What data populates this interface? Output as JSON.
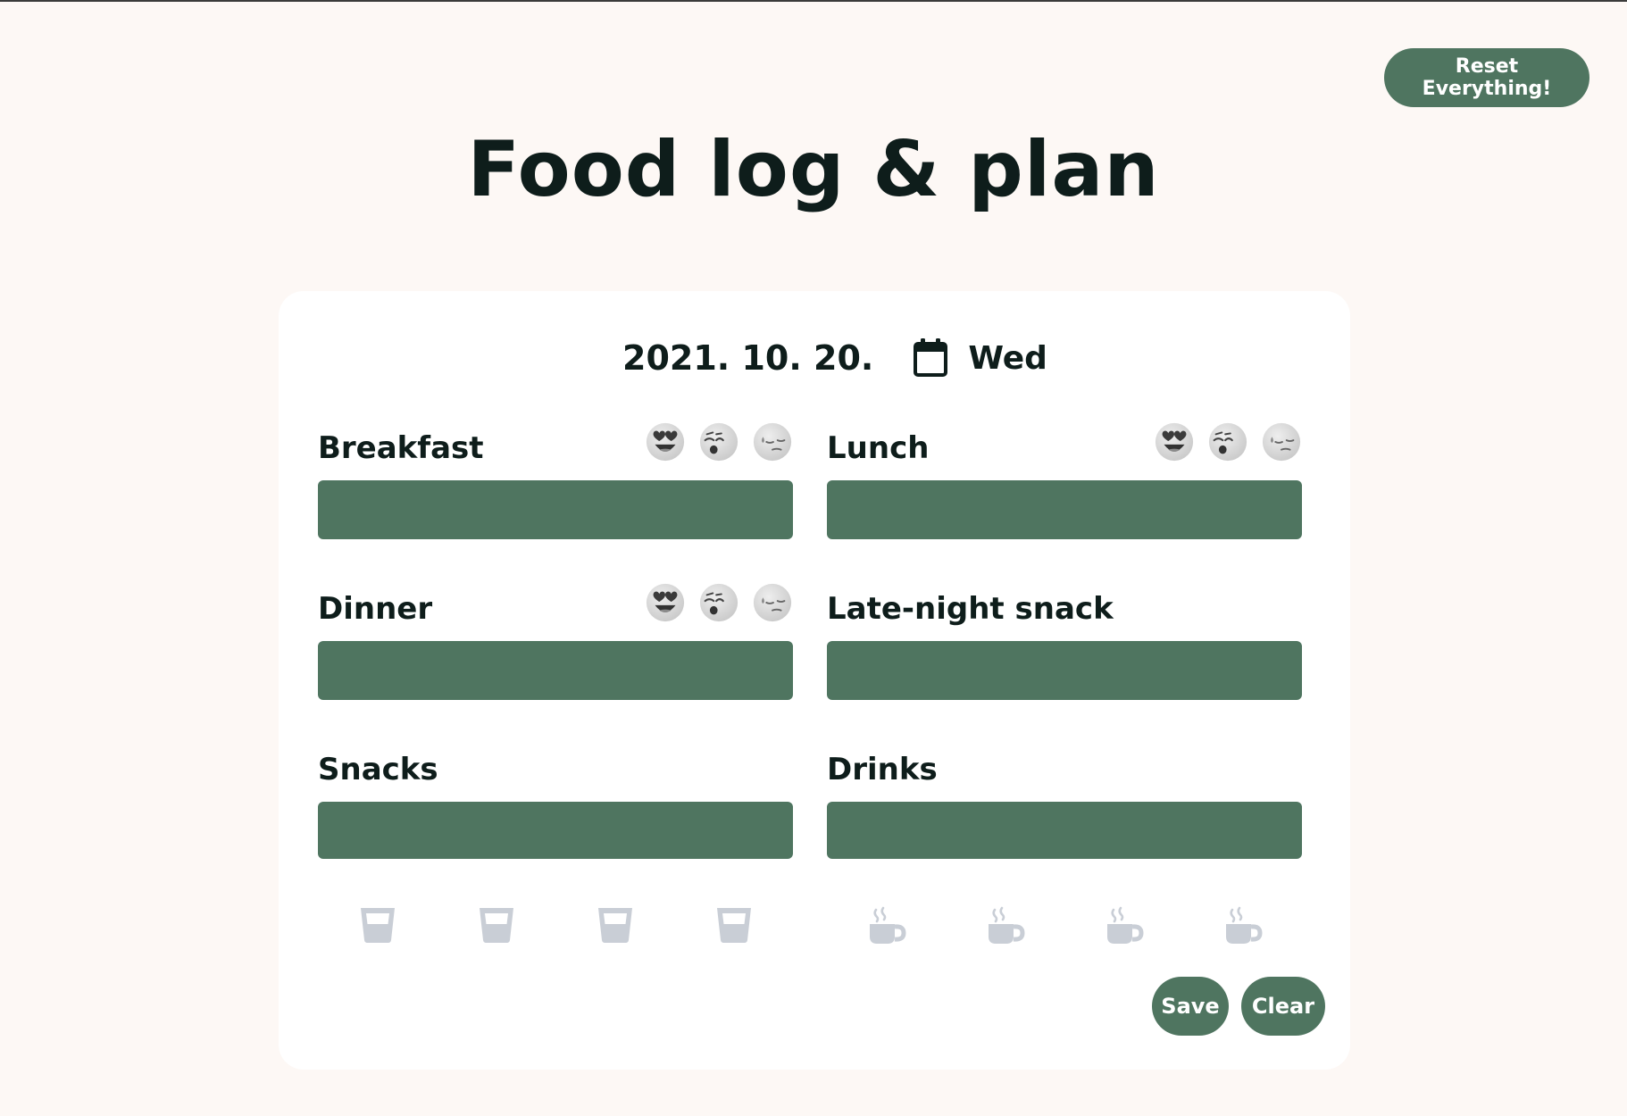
{
  "header": {
    "reset_label": "Reset Everything!",
    "title": "Food log & plan"
  },
  "date": {
    "value": "2021. 10. 20.",
    "day": "Wed",
    "calendar_icon": "calendar-icon"
  },
  "meals": [
    {
      "label": "Breakfast",
      "value": "",
      "moods": [
        "heart-eyes-face-icon",
        "neutral-face-icon",
        "sad-face-icon"
      ]
    },
    {
      "label": "Lunch",
      "value": "",
      "moods": [
        "heart-eyes-face-icon",
        "neutral-face-icon",
        "sad-face-icon"
      ]
    },
    {
      "label": "Dinner",
      "value": "",
      "moods": [
        "heart-eyes-face-icon",
        "neutral-face-icon",
        "sad-face-icon"
      ]
    },
    {
      "label": "Late-night snack",
      "value": ""
    },
    {
      "label": "Snacks",
      "value": ""
    },
    {
      "label": "Drinks",
      "value": ""
    }
  ],
  "trackers": {
    "water": {
      "icon": "water-glass-icon",
      "count": 4,
      "filled": 0
    },
    "coffee": {
      "icon": "coffee-cup-icon",
      "count": 4,
      "filled": 0
    }
  },
  "actions": {
    "save_label": "Save",
    "clear_label": "Clear"
  },
  "colors": {
    "accent": "#4f7560",
    "background": "#fdf8f5",
    "card": "#ffffff",
    "text": "#0e1d1b",
    "icon_inactive": "#c9ced6",
    "emoji_gray": "#d6d6d6"
  }
}
